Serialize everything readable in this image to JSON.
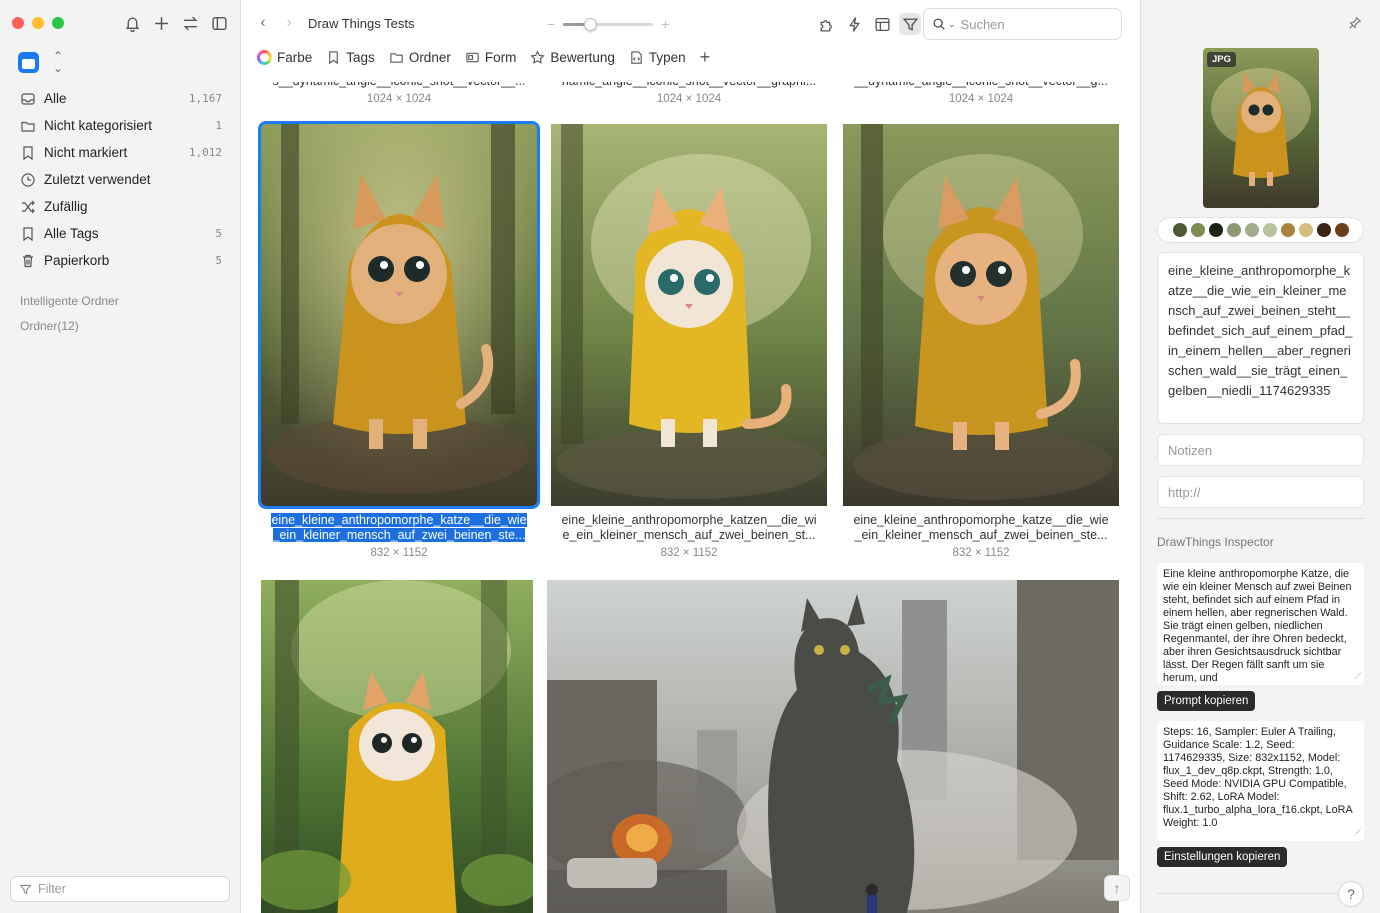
{
  "sidebar": {
    "items": [
      {
        "label": "Alle",
        "count": "1,167",
        "icon": "tray-icon"
      },
      {
        "label": "Nicht kategorisiert",
        "count": "1",
        "icon": "folder-icon"
      },
      {
        "label": "Nicht markiert",
        "count": "1,012",
        "icon": "bookmark-icon"
      },
      {
        "label": "Zuletzt verwendet",
        "count": "",
        "icon": "clock-icon"
      },
      {
        "label": "Zufällig",
        "count": "",
        "icon": "shuffle-icon"
      },
      {
        "label": "Alle Tags",
        "count": "5",
        "icon": "tag-icon"
      },
      {
        "label": "Papierkorb",
        "count": "5",
        "icon": "trash-icon"
      }
    ],
    "section_smart": "Intelligente Ordner",
    "section_folders": "Ordner(12)",
    "filter_placeholder": "Filter"
  },
  "toolbar": {
    "title": "Draw Things Tests",
    "zoom_level": 0.3,
    "search_placeholder": "Suchen"
  },
  "filterbar": {
    "color": "Farbe",
    "tags": "Tags",
    "folder": "Ordner",
    "shape": "Form",
    "rating": "Bewertung",
    "types": "Typen"
  },
  "grid": {
    "top_row": [
      {
        "caption": "s__dynamic_angle__iconic_shot__vector__...",
        "dims": "1024 × 1024"
      },
      {
        "caption": "namic_angle__iconic_shot__vector__graphi...",
        "dims": "1024 × 1024"
      },
      {
        "caption": "__dynamic_angle__iconic_shot__vector__g...",
        "dims": "1024 × 1024"
      }
    ],
    "row2": [
      {
        "line1": "eine_kleine_anthropomorphe_katze__die_wie",
        "line2": "_ein_kleiner_mensch_auf_zwei_beinen_ste...",
        "dims": "832 × 1152"
      },
      {
        "line1": "eine_kleine_anthropomorphe_katzen__die_wi",
        "line2": "e_ein_kleiner_mensch_auf_zwei_beinen_st...",
        "dims": "832 × 1152"
      },
      {
        "line1": "eine_kleine_anthropomorphe_katze__die_wie",
        "line2": "_ein_kleiner_mensch_auf_zwei_beinen_ste...",
        "dims": "832 × 1152"
      }
    ]
  },
  "inspector": {
    "badge": "JPG",
    "swatches": [
      "#4f5a35",
      "#7a8c4e",
      "#1f2418",
      "#8c9a74",
      "#a3ad8c",
      "#b8c29f",
      "#a8843f",
      "#d3bd7d",
      "#3b2414",
      "#6e3e1c"
    ],
    "filename": "eine_kleine_anthropomorphe_katze__die_wie_ein_kleiner_mensch_auf_zwei_beinen_steht__befindet_sich_auf_einem_pfad_in_einem_hellen__aber_regnerischen_wald__sie_trägt_einen_gelben__niedli_1174629335",
    "notes_placeholder": "Notizen",
    "url_placeholder": "http://",
    "section": "DrawThings Inspector",
    "prompt": "Eine kleine anthropomorphe Katze, die wie ein kleiner Mensch auf zwei Beinen steht, befindet sich auf einem Pfad in einem hellen, aber regnerischen Wald. Sie trägt einen gelben, niedlichen Regenmantel, der ihre Ohren bedeckt, aber ihren Gesichtsausdruck sichtbar lässt. Der Regen fällt sanft um sie herum, und",
    "copy_prompt": "Prompt kopieren",
    "settings": "Steps: 16, Sampler: Euler A Trailing, Guidance Scale: 1.2, Seed: 1174629335, Size: 832x1152, Model: flux_1_dev_q8p.ckpt, Strength: 1.0, Seed Mode: NVIDIA GPU Compatible, Shift: 2.62, LoRA Model: flux.1_turbo_alpha_lora_f16.ckpt, LoRA Weight: 1.0",
    "copy_settings": "Einstellungen kopieren",
    "help": "?"
  }
}
